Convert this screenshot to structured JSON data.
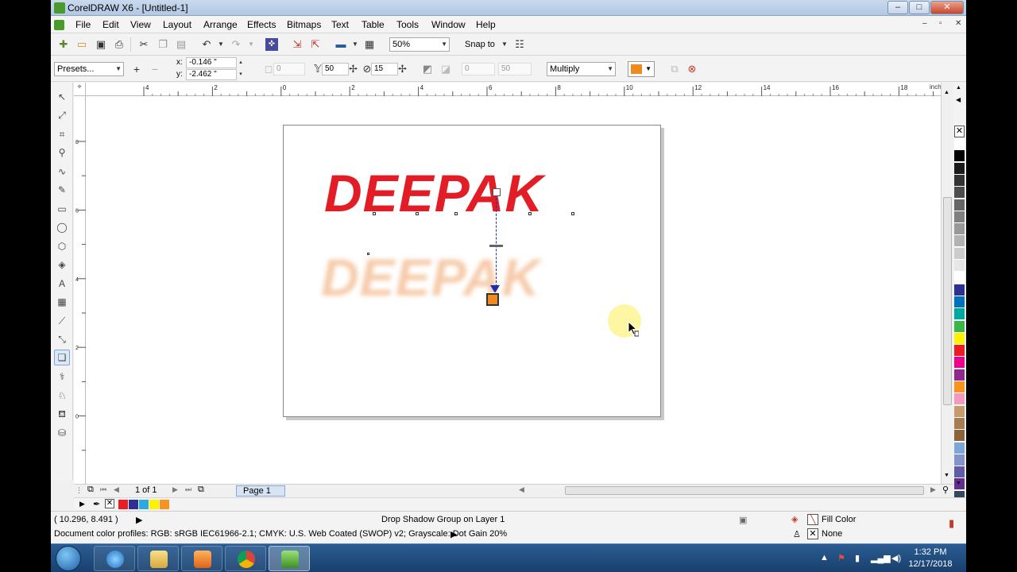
{
  "window": {
    "title": "CorelDRAW X6 - [Untitled-1]"
  },
  "menu": [
    "File",
    "Edit",
    "View",
    "Layout",
    "Arrange",
    "Effects",
    "Bitmaps",
    "Text",
    "Table",
    "Tools",
    "Window",
    "Help"
  ],
  "toolbar1": {
    "zoom": "50%",
    "snap_to": "Snap to"
  },
  "toolbar2": {
    "presets": "Presets...",
    "x": "-0.146 \"",
    "y": "-2.462 \"",
    "x_label": "x:",
    "y_label": "y:",
    "angle": "0",
    "opacity": "50",
    "feather": "15",
    "fade": "0",
    "stretch": "50",
    "blend_mode": "Multiply",
    "shadow_color": "#f08a1d"
  },
  "ruler": {
    "unit": "inches",
    "h_ticks": [
      "4",
      "2",
      "0",
      "2",
      "4",
      "6",
      "8",
      "10",
      "12",
      "14",
      "16",
      "18"
    ],
    "v_ticks": [
      "8",
      "6",
      "4",
      "2",
      "0"
    ]
  },
  "canvas": {
    "text": "DEEPAK",
    "shadow_text": "DEEPAK",
    "text_color": "#e21d25",
    "shadow_color": "#f3b98d"
  },
  "pager": {
    "count": "1 of 1",
    "tab": "Page 1"
  },
  "palette": [
    "#ffffff",
    "#000000",
    "#1a1a1a",
    "#333333",
    "#4d4d4d",
    "#666666",
    "#808080",
    "#999999",
    "#b3b3b3",
    "#cccccc",
    "#e6e6e6",
    "#ffffff",
    "#2e3192",
    "#0071bc",
    "#00a99d",
    "#39b54a",
    "#fff200",
    "#ed1c24",
    "#ec008c",
    "#92278f",
    "#f7941d",
    "#f49ac1",
    "#c69c6d",
    "#a67c52",
    "#8c6239",
    "#7da7d9",
    "#8493ca",
    "#605ca8",
    "#662d91",
    "#34495e"
  ],
  "doc_palette": [
    "#ed1c24",
    "#2e3192",
    "#29abe2",
    "#fff200",
    "#f7941d"
  ],
  "status": {
    "coords": "( 10.296, 8.491 )",
    "object": "Drop Shadow Group on Layer 1",
    "profiles": "Document color profiles: RGB: sRGB IEC61966-2.1; CMYK: U.S. Web Coated (SWOP) v2; Grayscale: Dot Gain 20%",
    "fill": "Fill Color",
    "outline": "None"
  },
  "taskbar": {
    "time": "1:32 PM",
    "date": "12/17/2018"
  }
}
